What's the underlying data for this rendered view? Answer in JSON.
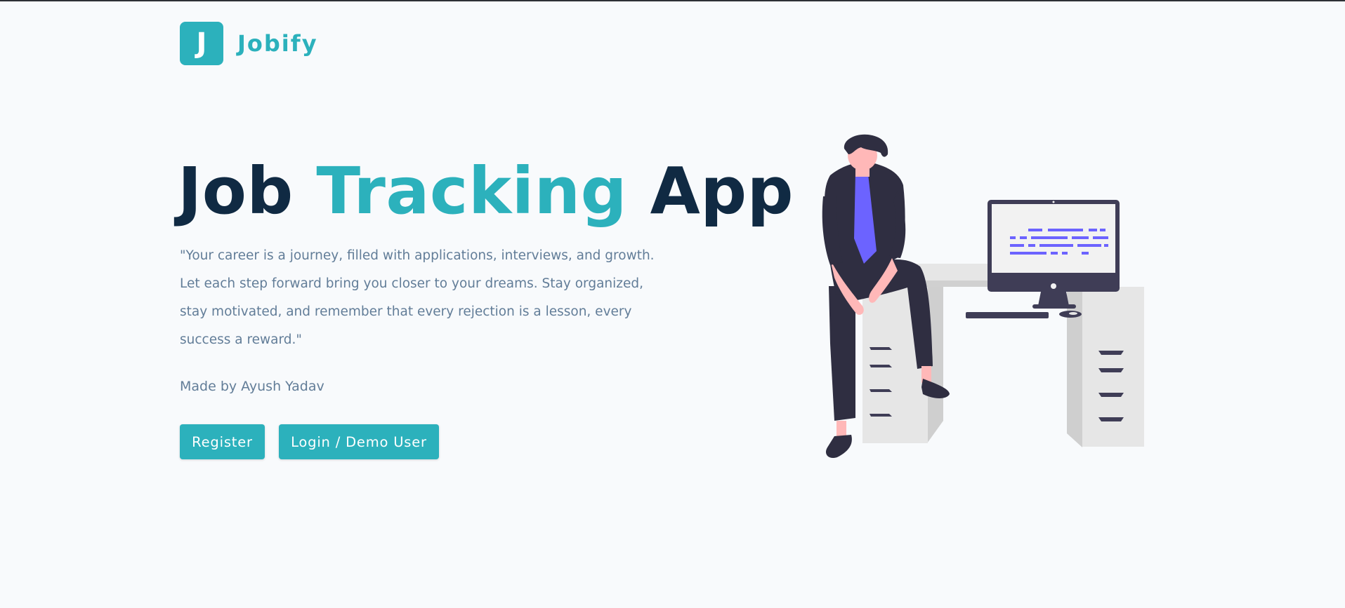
{
  "nav": {
    "logo_letter": "J",
    "brand": "Jobify"
  },
  "hero": {
    "title_part1": "Job",
    "title_accent": "Tracking",
    "title_part3": "App",
    "quote": "\"Your career is a journey, filled with applications, interviews, and growth. Let each step forward bring you closer to your dreams. Stay organized, stay motivated, and remember that every rejection is a lesson, every success a reward.\"",
    "credit": "Made by Ayush Yadav",
    "register_label": "Register",
    "login_label": "Login / Demo User"
  },
  "colors": {
    "primary": "#2cb1bc",
    "heading": "#102a43",
    "body_text": "#627d98",
    "background": "#f8fafc",
    "illustration_accent": "#6c63ff"
  }
}
